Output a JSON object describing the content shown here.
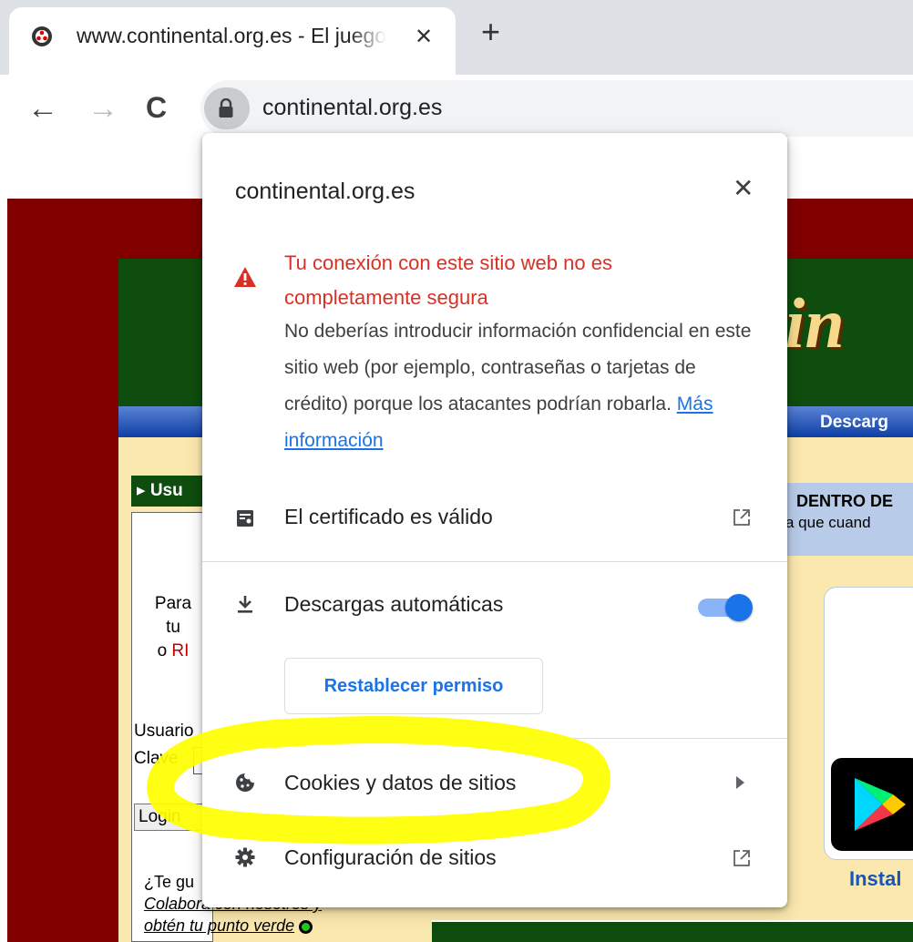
{
  "tab": {
    "title": "www.continental.org.es - El juego del continental online",
    "close": "✕",
    "new_tab": "+"
  },
  "toolbar": {
    "back": "←",
    "forward": "→",
    "reload": "C",
    "url": "continental.org.es"
  },
  "page": {
    "banner_logo": "tin",
    "nav_label": "Descarg",
    "user_section": "Usu",
    "para_line1": "Para",
    "para_line2": "tu",
    "para_line3_prefix": "o",
    "para_line3_red": "RI",
    "usuario_label": "Usuario",
    "clave_label": "Clave",
    "login_button": "Login",
    "collab_line1": "¿Te gu",
    "collab_line2": "Colabora con nosotros y",
    "collab_line3": "obtén tu punto verde",
    "right_title": "DENTRO DE",
    "right_sub": "a que cuand",
    "install_label": "Instal"
  },
  "popup": {
    "domain": "continental.org.es",
    "close": "✕",
    "warning_title": "Tu conexión con este sitio web no es completamente segura",
    "warning_body": "No deberías introducir información confidencial en este sitio web (por ejemplo, contraseñas o tarjetas de crédito) porque los atacantes podrían robarla.",
    "more_info": "Más información",
    "certificate": "El certificado es válido",
    "downloads": "Descargas automáticas",
    "reset_button": "Restablecer permiso",
    "cookies": "Cookies y datos de sitios",
    "site_settings": "Configuración de sitios",
    "downloads_enabled": true
  },
  "colors": {
    "warning_red": "#d93025",
    "link_blue": "#1a73e8",
    "highlight_yellow": "#ffff00",
    "page_maroon": "#800000",
    "banner_green": "#0e4d0e"
  },
  "icons": {
    "favicon": "continental-favicon-icon",
    "lock": "lock-icon",
    "warning": "warning-triangle-icon",
    "certificate": "certificate-icon",
    "download": "download-icon",
    "cookie": "cookie-icon",
    "settings": "gear-icon",
    "external": "open-external-icon",
    "chevron": "chevron-right-icon"
  }
}
